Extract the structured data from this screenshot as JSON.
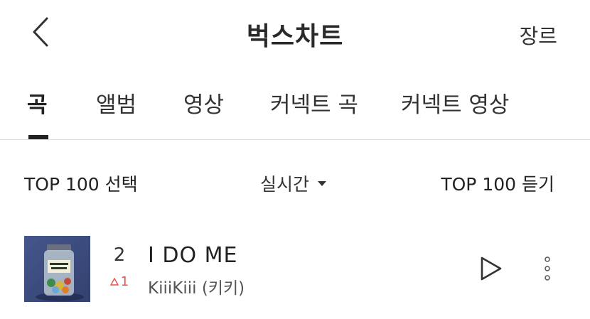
{
  "header": {
    "title": "벅스차트",
    "genre_label": "장르",
    "back_icon": "chevron-left-icon"
  },
  "tabs": [
    {
      "label": "곡",
      "active": true
    },
    {
      "label": "앨범",
      "active": false
    },
    {
      "label": "영상",
      "active": false
    },
    {
      "label": "커넥트 곡",
      "active": false
    },
    {
      "label": "커넥트 영상",
      "active": false
    }
  ],
  "controls": {
    "select_top": "TOP 100 선택",
    "sort_label": "실시간",
    "listen_top": "TOP 100 듣기"
  },
  "chart_list": [
    {
      "rank": "2",
      "rank_change": "1",
      "rank_direction": "up",
      "title": "I DO ME",
      "artist": "KiiiKiii (키키)"
    }
  ],
  "colors": {
    "accent_up": "#e8514f",
    "text_primary": "#222222",
    "divider": "#dcdcdc"
  }
}
